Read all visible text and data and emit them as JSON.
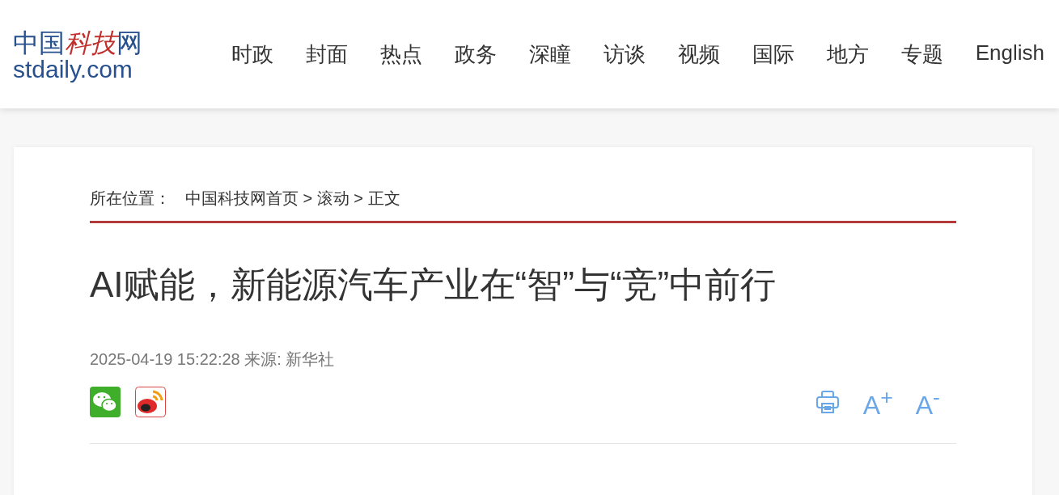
{
  "logo": {
    "name_parts": [
      {
        "text": "中国",
        "accent": false
      },
      {
        "text": "科技",
        "accent": true
      },
      {
        "text": "网",
        "accent": false
      }
    ],
    "domain": "stdaily.com"
  },
  "nav": [
    "时政",
    "封面",
    "热点",
    "政务",
    "深瞳",
    "访谈",
    "视频",
    "国际",
    "地方",
    "专题",
    "English"
  ],
  "breadcrumb": {
    "label": "所在位置：",
    "path": "中国科技网首页 > 滚动 > 正文"
  },
  "article": {
    "title": "AI赋能，新能源汽车产业在“智”与“竞”中前行",
    "meta": "2025-04-19 15:22:28 来源: 新华社"
  },
  "share": [
    {
      "kind": "wechat"
    },
    {
      "kind": "weibo"
    }
  ],
  "tools": [
    {
      "kind": "print"
    },
    {
      "kind": "font",
      "text": "A$^{+}$"
    },
    {
      "kind": "font",
      "text": "A$^{-}$"
    }
  ]
}
